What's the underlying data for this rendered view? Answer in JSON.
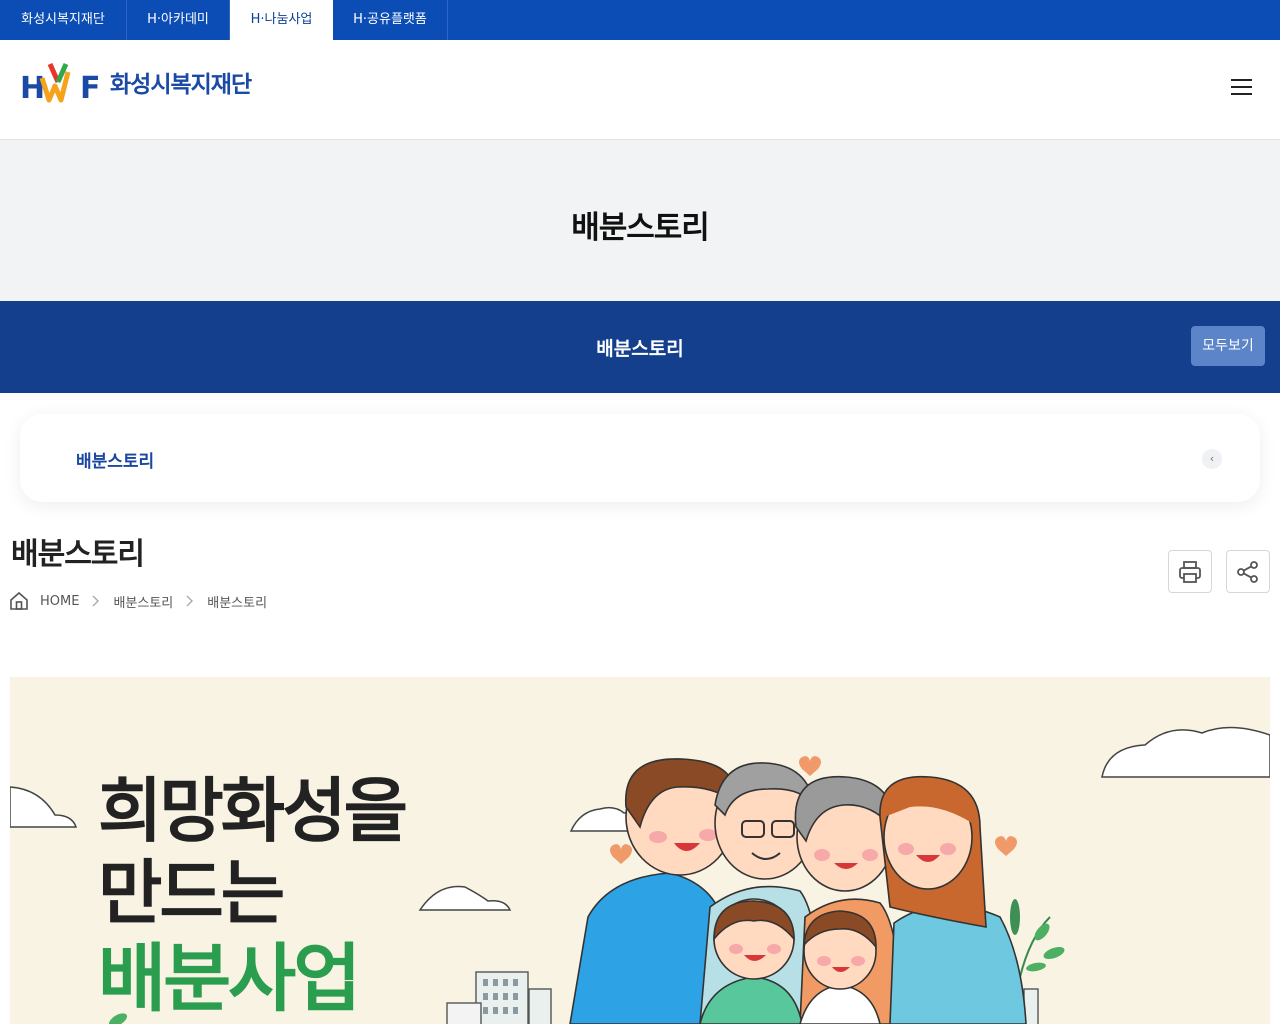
{
  "topbar": {
    "tabs": [
      {
        "label": "화성시복지재단",
        "active": false
      },
      {
        "label": "H·아카데미",
        "active": false
      },
      {
        "label": "H·나눔사업",
        "active": true
      },
      {
        "label": "H·공유플랫폼",
        "active": false
      }
    ]
  },
  "header": {
    "logo_mark": "HWF",
    "logo_text": "화성시복지재단",
    "menu_icon": "hamburger-icon"
  },
  "page": {
    "title": "배분스토리"
  },
  "subbar": {
    "title": "배분스토리",
    "view_all": "모두보기"
  },
  "local_nav": {
    "label": "배분스토리",
    "toggle_icon": "chevron-left-icon"
  },
  "content": {
    "title": "배분스토리",
    "print_icon": "print-icon",
    "share_icon": "share-icon"
  },
  "breadcrumb": {
    "home": "HOME",
    "items": [
      "배분스토리",
      "배분스토리"
    ]
  },
  "banner": {
    "line1": "희망화성을",
    "line2": "만드는",
    "line3": "배분사업"
  },
  "colors": {
    "brand_blue": "#0b4db5",
    "navy": "#133f8c",
    "green": "#2a9d4e",
    "banner_bg": "#f9f3e4"
  }
}
